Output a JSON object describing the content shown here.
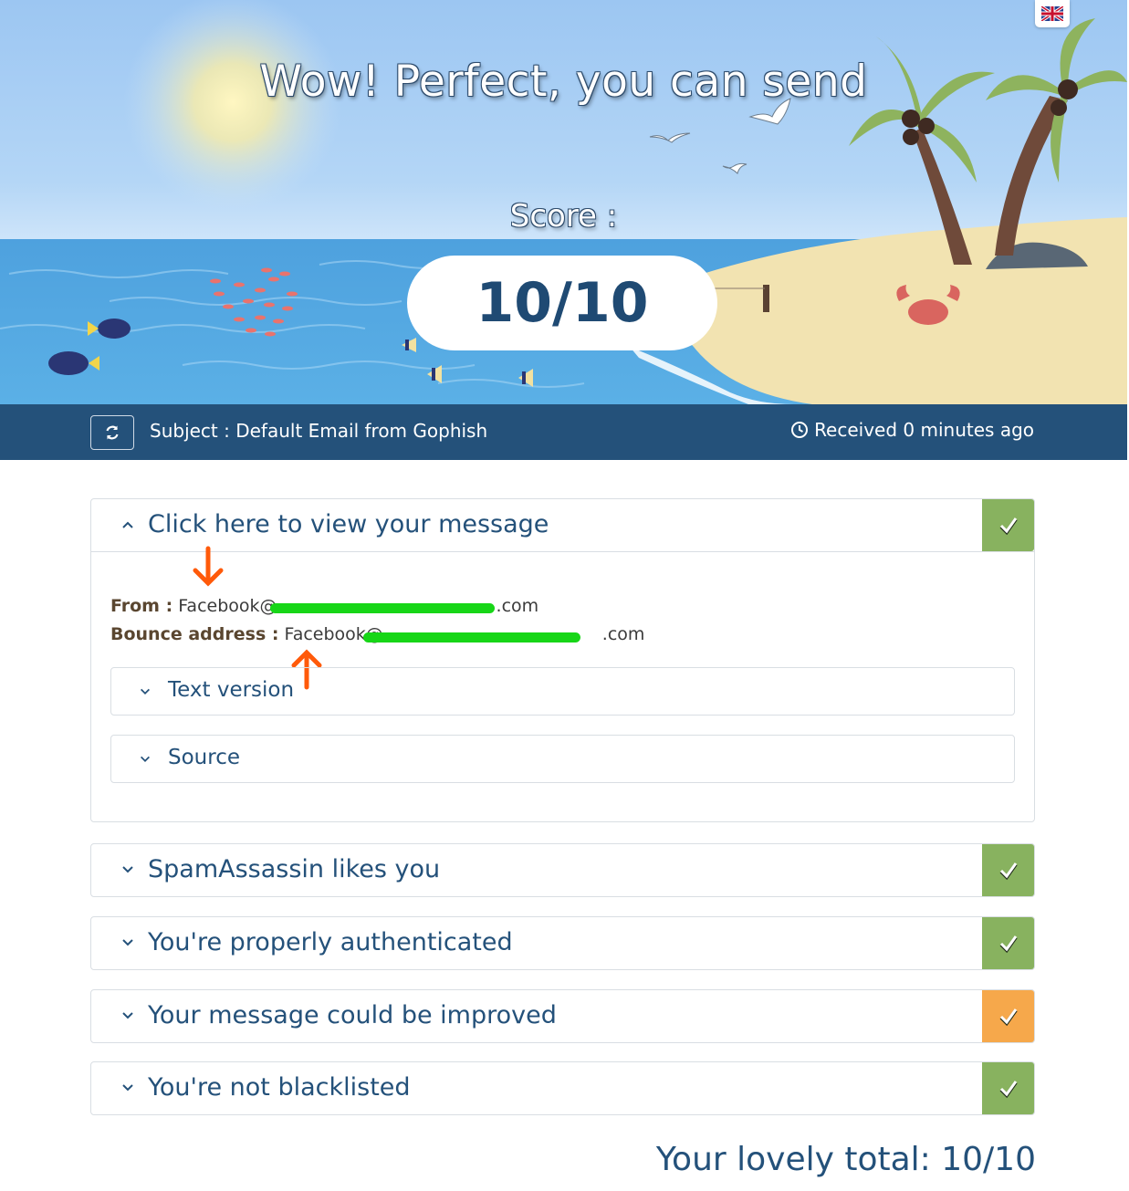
{
  "hero": {
    "title": "Wow! Perfect, you can send",
    "score_label": "Score :",
    "score": "10/10",
    "language_flag_icon": "uk-flag-icon"
  },
  "subject_bar": {
    "subject": "Subject : Default Email from Gophish",
    "received": "Received 0 minutes ago",
    "refresh_icon": "refresh-icon",
    "clock_icon": "clock-icon"
  },
  "message_panel": {
    "title": "Click here to view your message",
    "status": "pass",
    "from_label": "From :",
    "from_value_start": "Facebook@",
    "from_value_end": ".com",
    "bounce_label": "Bounce address :",
    "bounce_value_start": "Facebook@",
    "bounce_value_end": ".com",
    "sub_panels": [
      {
        "title": "Text version"
      },
      {
        "title": "Source"
      }
    ]
  },
  "checks": [
    {
      "title": "SpamAssassin likes you",
      "status": "pass",
      "color": "#88b25f"
    },
    {
      "title": "You're properly authenticated",
      "status": "pass",
      "color": "#88b25f"
    },
    {
      "title": "Your message could be improved",
      "status": "warning",
      "color": "#f6a84b"
    },
    {
      "title": "You're not blacklisted",
      "status": "pass",
      "color": "#88b25f"
    }
  ],
  "total": "Your lovely total: 10/10",
  "colors": {
    "primary": "#24517a",
    "pass": "#88b25f",
    "warning": "#f6a84b",
    "redaction": "#17d617",
    "annotation_arrow": "#ff5a0a"
  }
}
